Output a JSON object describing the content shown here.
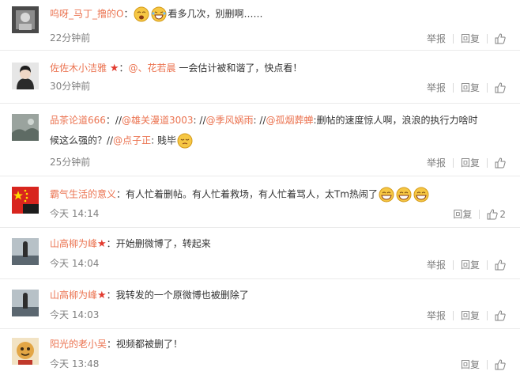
{
  "labels": {
    "report": "举报",
    "reply": "回复"
  },
  "comments": [
    {
      "name": "呜呀_马丁_撸的O",
      "sep": "：",
      "text": "看多几次，别删啊……",
      "time": "22分钟前",
      "likes": ""
    },
    {
      "name": "佐佐木小洁雅",
      "sep": "：",
      "mention": "@、花若晨",
      "text": " 一会估计被和谐了，快点看！",
      "time": "30分钟前",
      "likes": ""
    },
    {
      "name": "品茶论道666",
      "line1": [
        {
          "t": "：//",
          "m": false
        },
        {
          "t": "@雄关漫道3003",
          "m": true
        },
        {
          "t": ": //",
          "m": false
        },
        {
          "t": "@季风娲雨",
          "m": true
        },
        {
          "t": ": //",
          "m": false
        },
        {
          "t": "@孤烟葬蝉",
          "m": true
        },
        {
          "t": ":删帖的速度惊人啊，浪浪的执行力啥时",
          "m": false
        }
      ],
      "line2a": "候这么强的？//",
      "line2m": "@点子正",
      "line2b": ": 贱毕",
      "time": "25分钟前",
      "likes": ""
    },
    {
      "name": "霸气生活的意义",
      "sep": "：",
      "text": "有人忙着删帖。有人忙着救场，有人忙着骂人，太Tm热闹了",
      "time": "今天 14:14",
      "likes": "2"
    },
    {
      "name": "山高柳为峰",
      "sep": "：",
      "text": "开始删微博了，转起来",
      "time": "今天 14:04",
      "likes": ""
    },
    {
      "name": "山高柳为峰",
      "sep": "：",
      "text": "我转发的一个原微博也被删除了",
      "time": "今天 14:03",
      "likes": ""
    },
    {
      "name": "阳光的老小吴",
      "sep": "：",
      "text": "视频都被删了！",
      "time": "今天 13:48",
      "likes": ""
    }
  ]
}
